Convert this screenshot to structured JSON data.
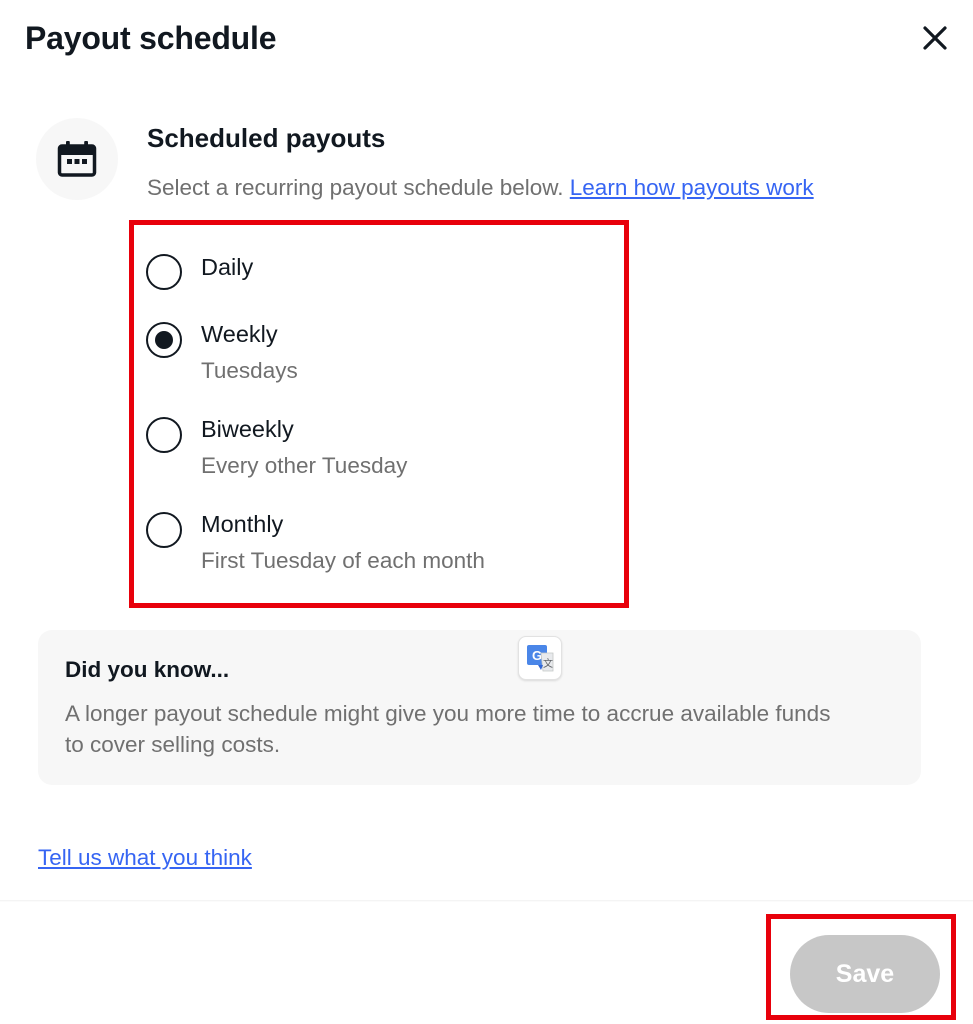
{
  "dialog": {
    "title": "Payout schedule",
    "close_icon": "close-icon"
  },
  "section": {
    "icon": "calendar-icon",
    "heading": "Scheduled payouts",
    "description": "Select a recurring payout schedule below.",
    "learn_link": "Learn how payouts work"
  },
  "schedule_options": [
    {
      "label": "Daily",
      "sublabel": "",
      "selected": false
    },
    {
      "label": "Weekly",
      "sublabel": "Tuesdays",
      "selected": true
    },
    {
      "label": "Biweekly",
      "sublabel": "Every other Tuesday",
      "selected": false
    },
    {
      "label": "Monthly",
      "sublabel": "First Tuesday of each month",
      "selected": false
    }
  ],
  "info_card": {
    "title": "Did you know...",
    "body": "A longer payout schedule might give you more time to accrue available funds to cover selling costs.",
    "icon": "translate-icon"
  },
  "feedback_link": "Tell us what you think",
  "footer": {
    "save_label": "Save",
    "save_disabled": true
  },
  "colors": {
    "link": "#3665f3",
    "highlight_border": "#e8000b",
    "disabled_button": "#c7c7c7",
    "text_primary": "#111820",
    "text_secondary": "#707070",
    "card_background": "#f7f7f7"
  }
}
